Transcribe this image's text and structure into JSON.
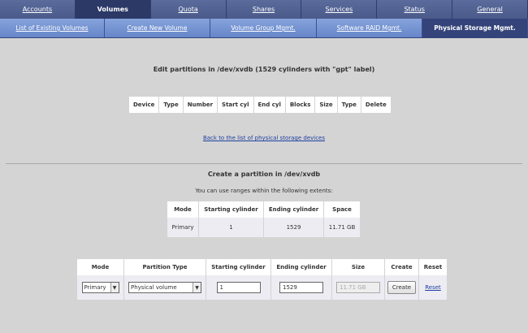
{
  "top_nav": [
    "Accounts",
    "Volumes",
    "Quota",
    "Shares",
    "Services",
    "Status",
    "General"
  ],
  "sub_nav": [
    "List of Existing Volumes",
    "Create New Volume",
    "Volume Group Mgmt.",
    "Software RAID Mgmt.",
    "Physical Storage Mgmt."
  ],
  "edit_title": "Edit partitions in /dev/xvdb (1529 cylinders with \"gpt\" label)",
  "partitions_headers": [
    "Device",
    "Type",
    "Number",
    "Start cyl",
    "End cyl",
    "Blocks",
    "Size",
    "Type",
    "Delete"
  ],
  "back_link": "Back to the list of physical storage devices",
  "create_title": "Create a partition in /dev/xvdb",
  "extents_note": "You can use ranges within the following extents:",
  "extents": {
    "headers": [
      "Mode",
      "Starting cylinder",
      "Ending cylinder",
      "Space"
    ],
    "row": [
      "Primary",
      "1",
      "1529",
      "11.71 GB"
    ]
  },
  "form": {
    "headers": [
      "Mode",
      "Partition Type",
      "Starting cylinder",
      "Ending cylinder",
      "Size",
      "Create",
      "Reset"
    ],
    "mode_value": "Primary",
    "type_value": "Physical volume",
    "start_value": "1",
    "end_value": "1529",
    "size_value": "11.71 GB",
    "create_label": "Create",
    "reset_label": "Reset"
  },
  "colors": {
    "top_nav_bg": "#4a5a8a",
    "sub_nav_bg": "#6f8fd0",
    "active_tab_bg": "#2c3866",
    "page_bg": "#d4d4d4",
    "cell_bg": "#ececf2",
    "link": "#2040a0"
  }
}
